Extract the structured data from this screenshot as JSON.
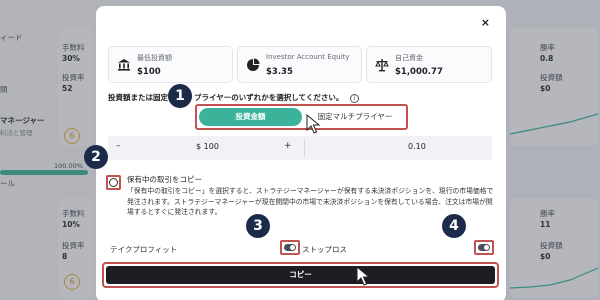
{
  "background": {
    "left_labels": [
      "ィード",
      "間",
      "マネージャー",
      "料法と管理",
      "ール"
    ],
    "left_progress": "100.00%",
    "card_labels": [
      "手数料",
      "投資率",
      "手数料",
      "投資率"
    ],
    "card_values": [
      "30%",
      "52",
      "10%",
      "8"
    ],
    "card_badges": [
      "6",
      "6"
    ],
    "right_labels": [
      "勝率",
      "投資額",
      "勝率",
      "投資額"
    ],
    "right_values": [
      "0.8",
      "$0",
      "11",
      "$0"
    ]
  },
  "modal": {
    "close_label": "×",
    "stats": [
      {
        "label": "最低投資額",
        "value": "$100",
        "icon": "bank-icon"
      },
      {
        "label": "Investor Account Equity",
        "value": "$3.35",
        "icon": "pie-chart-icon"
      },
      {
        "label": "自己資金",
        "value": "$1,000.77",
        "icon": "scale-icon"
      }
    ],
    "instruction_before": "投資額または固定",
    "instruction_after": "プライヤーのいずれかを選択してください。",
    "instruction_info": "i",
    "segment": {
      "active": "投資金額",
      "inactive": "固定マルチプライヤー"
    },
    "amount": {
      "minus": "–",
      "value": "$ 100",
      "plus": "+",
      "ratio": "0.10"
    },
    "copy_open": {
      "title": "保有中の取引をコピー",
      "description": "「保有中の取引をコピー」を選択すると、ストラテジーマネージャーが保有する未決済ポジションを、現行の市場価格で発注されます。ストラテジーマネージャーが現在開閉中の市場で未決済ポジションを保有している場合、注文は市場が開場するとすぐに発注されます。"
    },
    "take_profit_label": "テイクプロフィット",
    "stop_loss_label": "ストップロス",
    "copy_button_label": "コピー"
  },
  "badges": [
    "1",
    "2",
    "3",
    "4"
  ]
}
